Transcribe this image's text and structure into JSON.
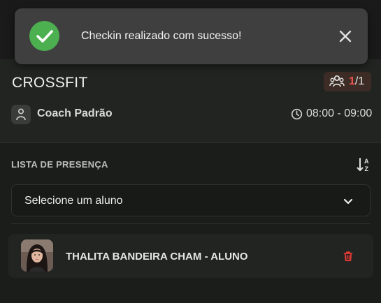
{
  "toast": {
    "message": "Checkin realizado com sucesso!",
    "icon": "check-circle-icon",
    "close_icon": "close-icon",
    "color_success": "#4caf50"
  },
  "class_card": {
    "title": "CROSSFIT",
    "capacity": {
      "current": "1",
      "max": "/1",
      "icon": "people-icon",
      "current_color": "#ef5350"
    },
    "coach": {
      "name": "Coach Padrão",
      "icon": "person-icon"
    },
    "schedule": {
      "time": "08:00 - 09:00",
      "icon": "clock-icon"
    }
  },
  "attendance": {
    "label": "LISTA DE PRESENÇA",
    "sort_icon": "sort-alpha-icon",
    "select": {
      "placeholder": "Selecione um aluno",
      "icon": "chevron-down-icon"
    },
    "students": [
      {
        "name": "THALITA BANDEIRA CHAM - ALUNO",
        "delete_icon": "trash-icon",
        "delete_color": "#e53935"
      }
    ]
  }
}
